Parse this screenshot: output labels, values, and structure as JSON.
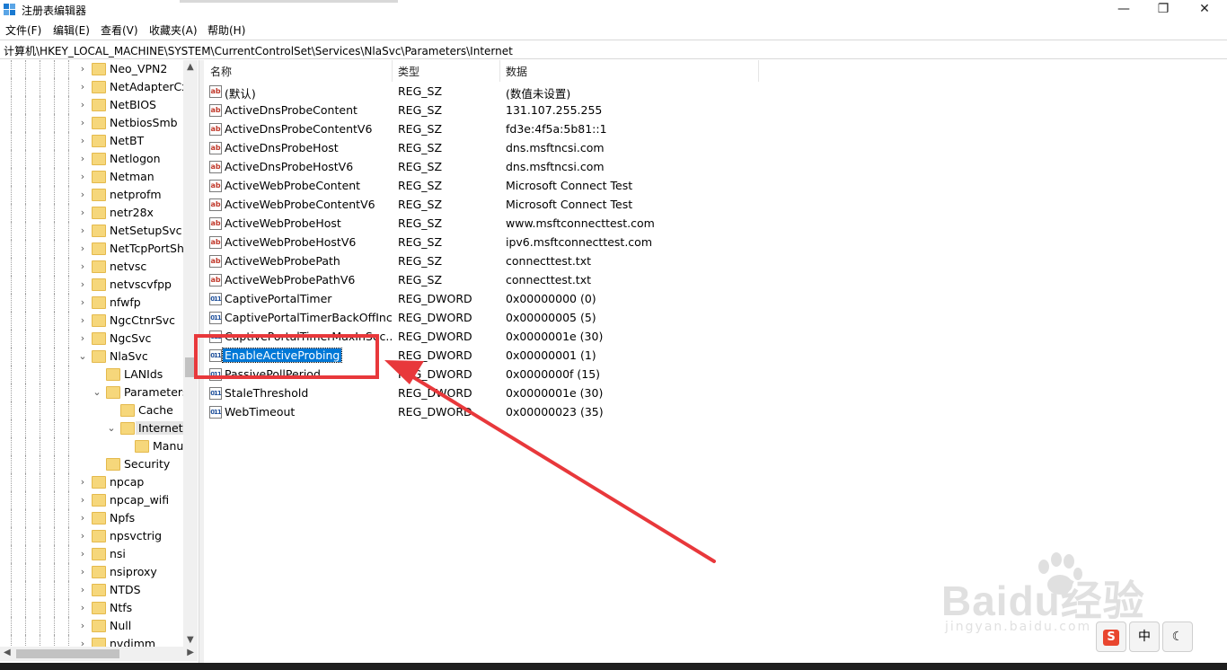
{
  "window": {
    "title": "注册表编辑器",
    "minimize": "—",
    "maximize": "❐",
    "close": "✕"
  },
  "menu": [
    "文件(F)",
    "编辑(E)",
    "查看(V)",
    "收藏夹(A)",
    "帮助(H)"
  ],
  "address": "计算机\\HKEY_LOCAL_MACHINE\\SYSTEM\\CurrentControlSet\\Services\\NlaSvc\\Parameters\\Internet",
  "tree": [
    {
      "label": "Neo_VPN2",
      "level": 0,
      "expander": "›"
    },
    {
      "label": "NetAdapterCx",
      "level": 0,
      "expander": "›"
    },
    {
      "label": "NetBIOS",
      "level": 0,
      "expander": "›"
    },
    {
      "label": "NetbiosSmb",
      "level": 0,
      "expander": "›"
    },
    {
      "label": "NetBT",
      "level": 0,
      "expander": "›"
    },
    {
      "label": "Netlogon",
      "level": 0,
      "expander": "›"
    },
    {
      "label": "Netman",
      "level": 0,
      "expander": "›"
    },
    {
      "label": "netprofm",
      "level": 0,
      "expander": "›"
    },
    {
      "label": "netr28x",
      "level": 0,
      "expander": "›"
    },
    {
      "label": "NetSetupSvc",
      "level": 0,
      "expander": "›"
    },
    {
      "label": "NetTcpPortSh",
      "level": 0,
      "expander": "›"
    },
    {
      "label": "netvsc",
      "level": 0,
      "expander": "›"
    },
    {
      "label": "netvscvfpp",
      "level": 0,
      "expander": "›"
    },
    {
      "label": "nfwfp",
      "level": 0,
      "expander": "›"
    },
    {
      "label": "NgcCtnrSvc",
      "level": 0,
      "expander": "›"
    },
    {
      "label": "NgcSvc",
      "level": 0,
      "expander": "›"
    },
    {
      "label": "NlaSvc",
      "level": 0,
      "expander": "⌄"
    },
    {
      "label": "LANIds",
      "level": 1,
      "expander": ""
    },
    {
      "label": "Parameters",
      "level": 1,
      "expander": "⌄"
    },
    {
      "label": "Cache",
      "level": 2,
      "expander": ""
    },
    {
      "label": "Internet",
      "level": 2,
      "expander": "⌄",
      "selected": true
    },
    {
      "label": "Manu",
      "level": 3,
      "expander": ""
    },
    {
      "label": "Security",
      "level": 1,
      "expander": ""
    },
    {
      "label": "npcap",
      "level": 0,
      "expander": "›"
    },
    {
      "label": "npcap_wifi",
      "level": 0,
      "expander": "›"
    },
    {
      "label": "Npfs",
      "level": 0,
      "expander": "›"
    },
    {
      "label": "npsvctrig",
      "level": 0,
      "expander": "›"
    },
    {
      "label": "nsi",
      "level": 0,
      "expander": "›"
    },
    {
      "label": "nsiproxy",
      "level": 0,
      "expander": "›"
    },
    {
      "label": "NTDS",
      "level": 0,
      "expander": "›"
    },
    {
      "label": "Ntfs",
      "level": 0,
      "expander": "›"
    },
    {
      "label": "Null",
      "level": 0,
      "expander": "›"
    },
    {
      "label": "nvdimm",
      "level": 0,
      "expander": "›"
    }
  ],
  "columns": {
    "name": "名称",
    "type": "类型",
    "data": "数据"
  },
  "values": [
    {
      "name": "(默认)",
      "type": "REG_SZ",
      "data": "(数值未设置)",
      "kind": "sz"
    },
    {
      "name": "ActiveDnsProbeContent",
      "type": "REG_SZ",
      "data": "131.107.255.255",
      "kind": "sz"
    },
    {
      "name": "ActiveDnsProbeContentV6",
      "type": "REG_SZ",
      "data": "fd3e:4f5a:5b81::1",
      "kind": "sz"
    },
    {
      "name": "ActiveDnsProbeHost",
      "type": "REG_SZ",
      "data": "dns.msftncsi.com",
      "kind": "sz"
    },
    {
      "name": "ActiveDnsProbeHostV6",
      "type": "REG_SZ",
      "data": "dns.msftncsi.com",
      "kind": "sz"
    },
    {
      "name": "ActiveWebProbeContent",
      "type": "REG_SZ",
      "data": "Microsoft Connect Test",
      "kind": "sz"
    },
    {
      "name": "ActiveWebProbeContentV6",
      "type": "REG_SZ",
      "data": "Microsoft Connect Test",
      "kind": "sz"
    },
    {
      "name": "ActiveWebProbeHost",
      "type": "REG_SZ",
      "data": "www.msftconnecttest.com",
      "kind": "sz"
    },
    {
      "name": "ActiveWebProbeHostV6",
      "type": "REG_SZ",
      "data": "ipv6.msftconnecttest.com",
      "kind": "sz"
    },
    {
      "name": "ActiveWebProbePath",
      "type": "REG_SZ",
      "data": "connecttest.txt",
      "kind": "sz"
    },
    {
      "name": "ActiveWebProbePathV6",
      "type": "REG_SZ",
      "data": "connecttest.txt",
      "kind": "sz"
    },
    {
      "name": "CaptivePortalTimer",
      "type": "REG_DWORD",
      "data": "0x00000000 (0)",
      "kind": "dword"
    },
    {
      "name": "CaptivePortalTimerBackOffInc...",
      "type": "REG_DWORD",
      "data": "0x00000005 (5)",
      "kind": "dword"
    },
    {
      "name": "CaptivePortalTimerMaxInSec...",
      "type": "REG_DWORD",
      "data": "0x0000001e (30)",
      "kind": "dword"
    },
    {
      "name": "EnableActiveProbing",
      "type": "REG_DWORD",
      "data": "0x00000001 (1)",
      "kind": "dword",
      "selected": true
    },
    {
      "name": "PassivePollPeriod",
      "type": "REG_DWORD",
      "data": "0x0000000f (15)",
      "kind": "dword"
    },
    {
      "name": "StaleThreshold",
      "type": "REG_DWORD",
      "data": "0x0000001e (30)",
      "kind": "dword"
    },
    {
      "name": "WebTimeout",
      "type": "REG_DWORD",
      "data": "0x00000023 (35)",
      "kind": "dword"
    }
  ],
  "icons": {
    "sz": "ab",
    "dword": "011"
  },
  "annotation_color": "#e8383b",
  "selection_color": "#0078d7",
  "watermark": {
    "brand": "Baidu经验",
    "url": "jingyan.baidu.com"
  },
  "ime": {
    "logo": "S",
    "mode": "中",
    "moon": "☾"
  },
  "scroll": {
    "up": "▲",
    "down": "▼",
    "left": "◀",
    "right": "▶"
  }
}
